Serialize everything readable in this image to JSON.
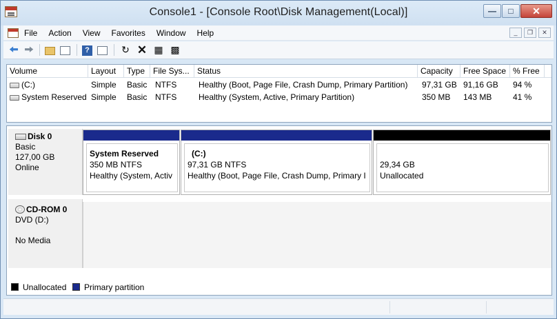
{
  "window": {
    "title": "Console1 - [Console Root\\Disk Management(Local)]"
  },
  "title_buttons": [
    "minimize",
    "maximize",
    "close"
  ],
  "menu": {
    "items": [
      "File",
      "Action",
      "View",
      "Favorites",
      "Window",
      "Help"
    ]
  },
  "toolbar": {
    "icons": [
      "back-arrow-icon",
      "forward-arrow-icon",
      "folder-up-icon",
      "show-hide-tree-icon",
      "help-icon",
      "properties-icon",
      "refresh-icon",
      "delete-icon",
      "rescan-icon",
      "disk-properties-icon"
    ]
  },
  "volume_list": {
    "columns": [
      "Volume",
      "Layout",
      "Type",
      "File Sys...",
      "Status",
      "Capacity",
      "Free Space",
      "% Free"
    ],
    "rows": [
      {
        "volume": "(C:)",
        "layout": "Simple",
        "type": "Basic",
        "fs": "NTFS",
        "status": "Healthy (Boot, Page File, Crash Dump, Primary Partition)",
        "capacity": "97,31 GB",
        "free": "91,16 GB",
        "pct": "94 %"
      },
      {
        "volume": "System Reserved",
        "layout": "Simple",
        "type": "Basic",
        "fs": "NTFS",
        "status": "Healthy (System, Active, Primary Partition)",
        "capacity": "350 MB",
        "free": "143 MB",
        "pct": "41 %"
      }
    ]
  },
  "disks": [
    {
      "name": "Disk 0",
      "type": "Basic",
      "size": "127,00 GB",
      "state": "Online",
      "partitions": [
        {
          "name": "System Reserved",
          "size": "350 MB NTFS",
          "status": "Healthy (System, Activ",
          "kind": "primary"
        },
        {
          "name": "(C:)",
          "size": "97,31 GB NTFS",
          "status": "Healthy (Boot, Page File, Crash Dump, Primary I",
          "kind": "primary"
        },
        {
          "name": "",
          "size": "29,34 GB",
          "status": "Unallocated",
          "kind": "unallocated"
        }
      ]
    },
    {
      "name": "CD-ROM 0",
      "type": "DVD (D:)",
      "state": "No Media"
    }
  ],
  "legend": {
    "items": [
      {
        "label": "Unallocated",
        "color": "#000000"
      },
      {
        "label": "Primary partition",
        "color": "#1a2a8c"
      }
    ]
  },
  "colors": {
    "primary": "#1a2a8c",
    "unallocated": "#000000",
    "title_bg": "#d8e7f5"
  }
}
